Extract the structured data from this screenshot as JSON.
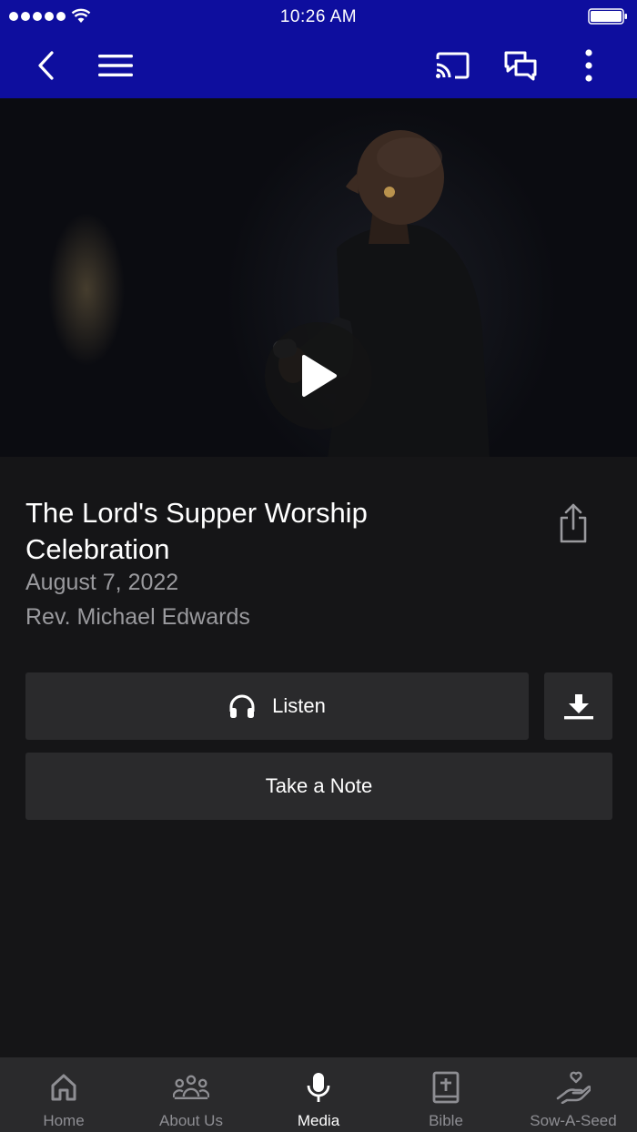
{
  "status_bar": {
    "time": "10:26 AM"
  },
  "nav": {
    "back_icon": "chevron-left-icon",
    "menu_icon": "hamburger-menu-icon",
    "cast_icon": "cast-icon",
    "chat_icon": "chat-bubbles-icon",
    "more_icon": "more-vertical-icon"
  },
  "video": {
    "play_icon": "play-icon"
  },
  "sermon": {
    "title": "The Lord's Supper Worship Celebration",
    "date": "August 7, 2022",
    "speaker": "Rev. Michael Edwards"
  },
  "actions": {
    "listen_label": "Listen",
    "note_label": "Take a Note"
  },
  "tabs": [
    {
      "label": "Home",
      "icon": "home-icon"
    },
    {
      "label": "About Us",
      "icon": "people-icon"
    },
    {
      "label": "Media",
      "icon": "microphone-icon",
      "active": true
    },
    {
      "label": "Bible",
      "icon": "bible-icon"
    },
    {
      "label": "Sow-A-Seed",
      "icon": "hand-heart-icon"
    }
  ],
  "colors": {
    "nav_background": "#0e0e9e",
    "page_background": "#151517",
    "button_background": "#2a2a2c",
    "secondary_text": "#9a9a9e",
    "inactive_tab": "#8e8e93"
  }
}
